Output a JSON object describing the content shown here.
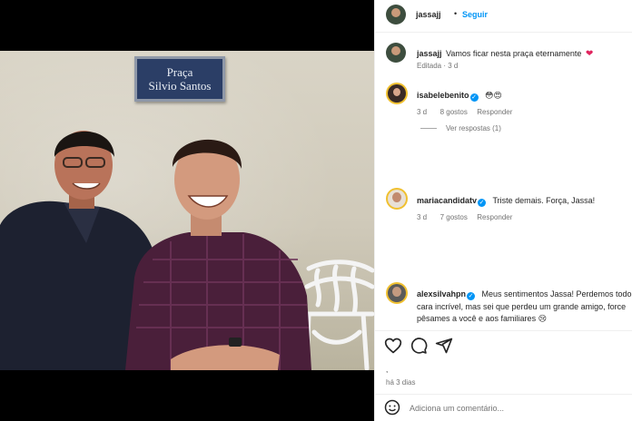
{
  "post": {
    "author": "jassajj",
    "separator": "•",
    "follow_label": "Seguir",
    "plaque_line1": "Praça",
    "plaque_line2": "Silvio Santos"
  },
  "caption": {
    "username": "jassajj",
    "text": "Vamos ficar nesta praça eternamente",
    "emoji": "❤",
    "meta": "Editada · 3 d"
  },
  "comments": [
    {
      "username": "isabelebenito",
      "text": "😳😍",
      "time": "3 d",
      "likes": "8 gostos",
      "reply": "Responder",
      "view_replies": "Ver respostas (1)"
    },
    {
      "username": "mariacandidatv",
      "text": "Triste demais. Força, Jassa!",
      "time": "3 d",
      "likes": "7 gostos",
      "reply": "Responder"
    },
    {
      "username": "alexsilvahpn",
      "text_line1": "Meus sentimentos Jassa! Perdemos todos um",
      "text_line2": "cara incrível, mas sei que perdeu um grande amigo, force",
      "text_line3": "pêsames a você e aos familiares 😢"
    }
  ],
  "footer": {
    "dot": ",",
    "date": "há 3 dias",
    "comment_placeholder": "Adiciona um comentário..."
  },
  "icons": {
    "like": "heart-outline-icon",
    "comment": "comment-bubble-icon",
    "share": "paper-plane-icon",
    "emoji": "smiley-icon"
  },
  "colors": {
    "follow_blue": "#0095f6",
    "verified_blue": "#0095f6",
    "heart_red": "#e0245e"
  }
}
